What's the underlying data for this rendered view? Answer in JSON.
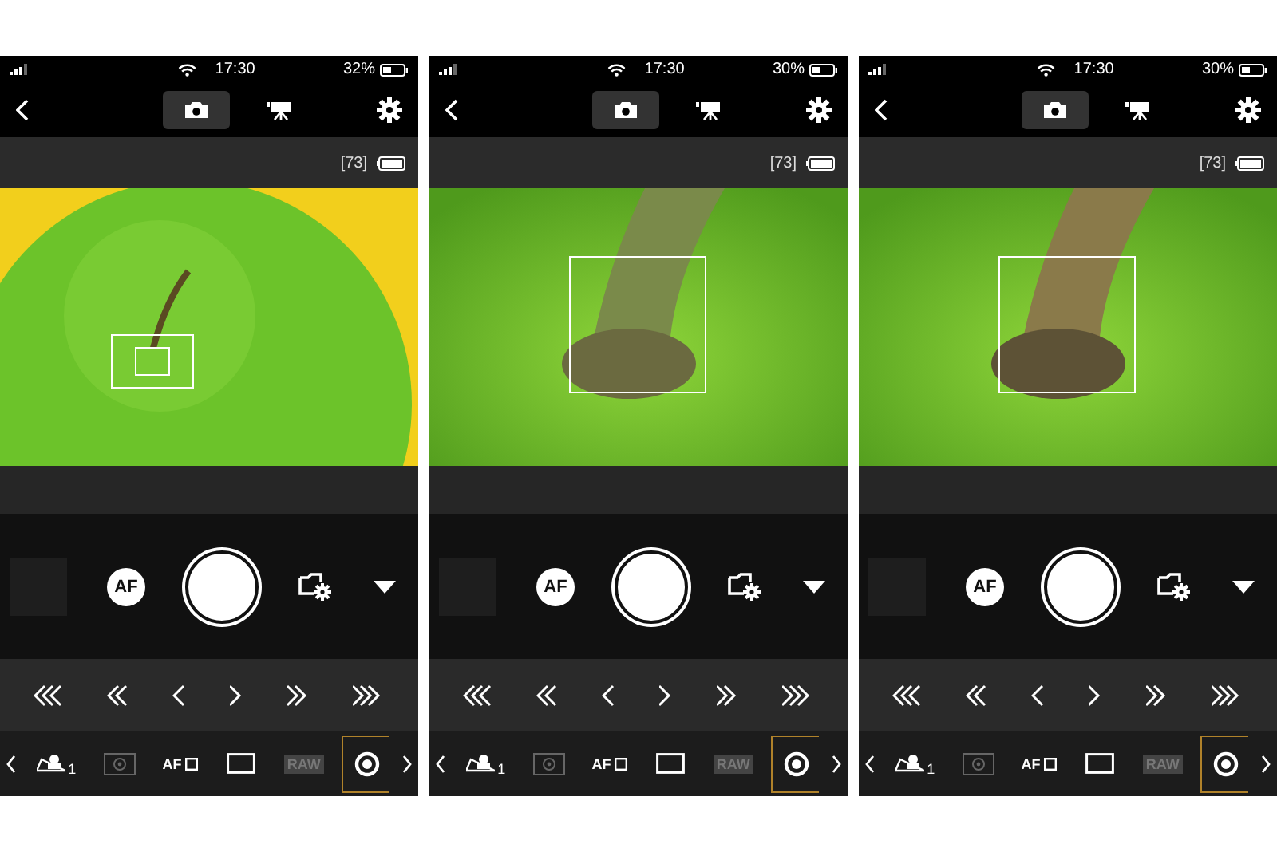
{
  "phones": [
    {
      "status_bar": {
        "time": "17:30",
        "battery": "32%"
      },
      "mode_tabs": [
        {
          "kind": "photo",
          "selected": true
        },
        {
          "kind": "video",
          "selected": false
        }
      ],
      "shots_remaining": "[73]",
      "viewfinder": {
        "kind": "wide"
      },
      "af_button": "AF",
      "toolbar": [
        {
          "kind": "drive",
          "label": "1",
          "selected": false,
          "disabled": false
        },
        {
          "kind": "metering",
          "selected": false,
          "disabled": true
        },
        {
          "kind": "af-area",
          "label": "AF",
          "selected": false,
          "disabled": false
        },
        {
          "kind": "aspect",
          "selected": false,
          "disabled": false
        },
        {
          "kind": "raw",
          "label": "RAW",
          "selected": false,
          "disabled": true
        },
        {
          "kind": "target",
          "selected": true,
          "disabled": false
        }
      ]
    },
    {
      "status_bar": {
        "time": "17:30",
        "battery": "30%"
      },
      "mode_tabs": [
        {
          "kind": "photo",
          "selected": true
        },
        {
          "kind": "video",
          "selected": false
        }
      ],
      "shots_remaining": "[73]",
      "viewfinder": {
        "kind": "magnified"
      },
      "af_button": "AF",
      "toolbar": [
        {
          "kind": "drive",
          "label": "1",
          "selected": false,
          "disabled": false
        },
        {
          "kind": "metering",
          "selected": false,
          "disabled": true
        },
        {
          "kind": "af-area",
          "label": "AF",
          "selected": false,
          "disabled": false
        },
        {
          "kind": "aspect",
          "selected": false,
          "disabled": false
        },
        {
          "kind": "raw",
          "label": "RAW",
          "selected": false,
          "disabled": true
        },
        {
          "kind": "target",
          "selected": true,
          "disabled": false
        }
      ]
    },
    {
      "status_bar": {
        "time": "17:30",
        "battery": "30%"
      },
      "mode_tabs": [
        {
          "kind": "photo",
          "selected": true
        },
        {
          "kind": "video",
          "selected": false
        }
      ],
      "shots_remaining": "[73]",
      "viewfinder": {
        "kind": "focused"
      },
      "af_button": "AF",
      "toolbar": [
        {
          "kind": "drive",
          "label": "1",
          "selected": false,
          "disabled": false
        },
        {
          "kind": "metering",
          "selected": false,
          "disabled": true
        },
        {
          "kind": "af-area",
          "label": "AF",
          "selected": false,
          "disabled": false
        },
        {
          "kind": "aspect",
          "selected": false,
          "disabled": false
        },
        {
          "kind": "raw",
          "label": "RAW",
          "selected": false,
          "disabled": true
        },
        {
          "kind": "target",
          "selected": true,
          "disabled": false
        }
      ]
    }
  ]
}
